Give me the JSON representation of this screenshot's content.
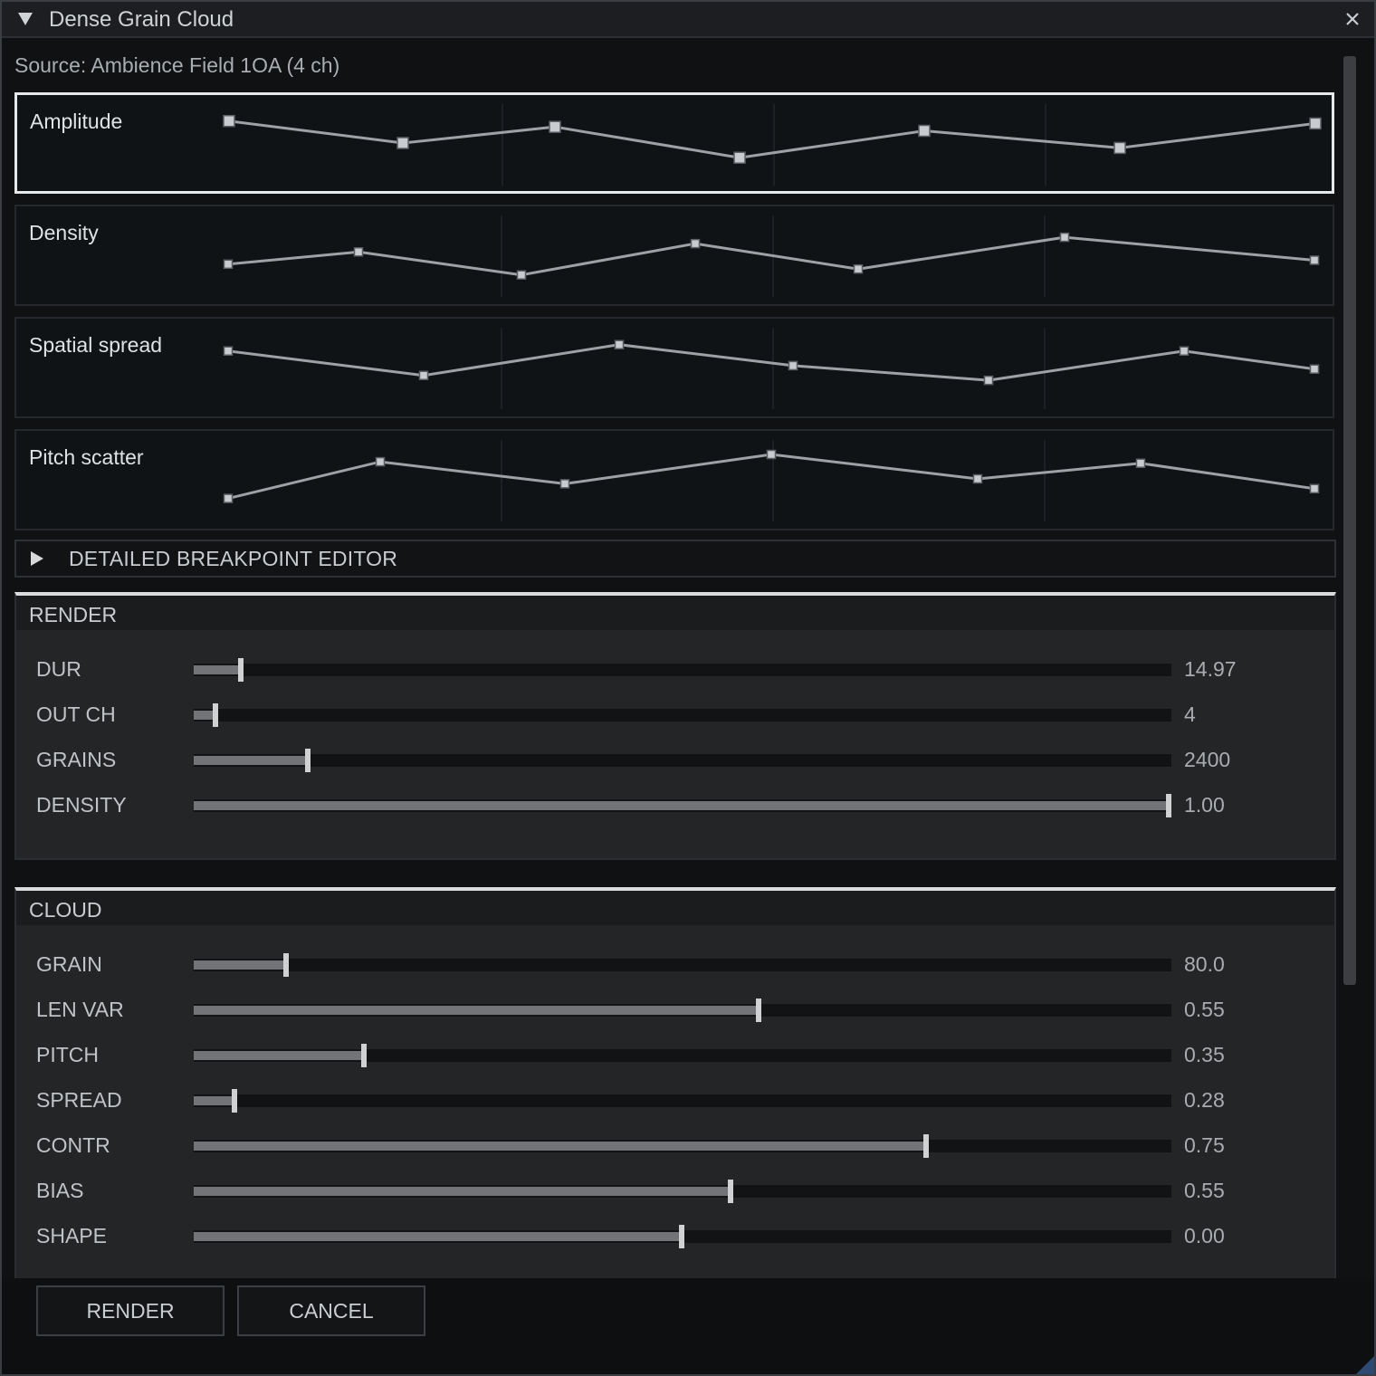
{
  "window": {
    "title": "Dense Grain Cloud",
    "collapse_icon": "triangle-down-icon",
    "close_icon": "close-icon",
    "close_glyph": "✕"
  },
  "source": {
    "label": "Source: Ambience Field 1OA  (4 ch)"
  },
  "envelopes": [
    {
      "label": "Amplitude",
      "selected": true,
      "points": [
        [
          0,
          0.95
        ],
        [
          0.16,
          0.5
        ],
        [
          0.3,
          0.83
        ],
        [
          0.47,
          0.2
        ],
        [
          0.64,
          0.75
        ],
        [
          0.82,
          0.4
        ],
        [
          1,
          0.9
        ]
      ]
    },
    {
      "label": "Density",
      "selected": false,
      "points": [
        [
          0,
          0.3
        ],
        [
          0.12,
          0.55
        ],
        [
          0.27,
          0.08
        ],
        [
          0.43,
          0.72
        ],
        [
          0.58,
          0.2
        ],
        [
          0.77,
          0.85
        ],
        [
          1,
          0.38
        ]
      ]
    },
    {
      "label": "Spatial spread",
      "selected": false,
      "points": [
        [
          0,
          0.82
        ],
        [
          0.18,
          0.32
        ],
        [
          0.36,
          0.95
        ],
        [
          0.52,
          0.52
        ],
        [
          0.7,
          0.22
        ],
        [
          0.88,
          0.82
        ],
        [
          1,
          0.45
        ]
      ]
    },
    {
      "label": "Pitch scatter",
      "selected": false,
      "points": [
        [
          0,
          0.1
        ],
        [
          0.14,
          0.85
        ],
        [
          0.31,
          0.4
        ],
        [
          0.5,
          1
        ],
        [
          0.69,
          0.5
        ],
        [
          0.84,
          0.82
        ],
        [
          1,
          0.3
        ]
      ]
    }
  ],
  "breakpoint_editor": {
    "label": "DETAILED BREAKPOINT EDITOR",
    "arrow_icon": "triangle-right-icon"
  },
  "render_section": {
    "title": "RENDER",
    "params": [
      {
        "label": "DUR",
        "value": "14.97",
        "fraction": 0.048
      },
      {
        "label": "OUT CH",
        "value": "4",
        "fraction": 0.022
      },
      {
        "label": "GRAINS",
        "value": "2400",
        "fraction": 0.117
      },
      {
        "label": "DENSITY",
        "value": "1.00",
        "fraction": 0.997
      }
    ]
  },
  "cloud_section": {
    "title": "CLOUD",
    "params": [
      {
        "label": "GRAIN",
        "value": "80.0",
        "fraction": 0.094
      },
      {
        "label": "LEN VAR",
        "value": "0.55",
        "fraction": 0.578
      },
      {
        "label": "PITCH",
        "value": "0.35",
        "fraction": 0.174
      },
      {
        "label": "SPREAD",
        "value": "0.28",
        "fraction": 0.042
      },
      {
        "label": "CONTR",
        "value": "0.75",
        "fraction": 0.749
      },
      {
        "label": "BIAS",
        "value": "0.55",
        "fraction": 0.549
      },
      {
        "label": "SHAPE",
        "value": "0.00",
        "fraction": 0.499
      }
    ]
  },
  "footer": {
    "render_label": "RENDER",
    "cancel_label": "CANCEL"
  },
  "colors": {
    "panel_bg": "#101316",
    "curve": "#9ea2a7",
    "point_fill": "#c8ccd0",
    "selected_border": "#e6e8ea",
    "slider_fill": "#727477",
    "slider_knob": "#cfd1d3",
    "grip_accent": "#2e4a73"
  }
}
